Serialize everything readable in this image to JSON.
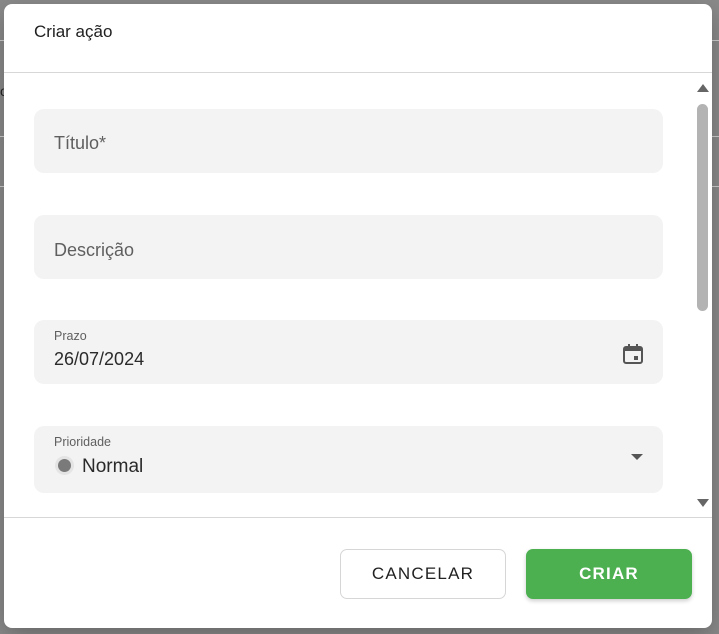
{
  "dialog": {
    "title": "Criar ação"
  },
  "form": {
    "title_field": {
      "placeholder": "Título*"
    },
    "description_field": {
      "placeholder": "Descrição"
    },
    "deadline_field": {
      "label": "Prazo",
      "value": "26/07/2024",
      "icon": "calendar-icon"
    },
    "priority_field": {
      "label": "Prioridade",
      "value": "Normal",
      "indicator_color": "#7a7a7a",
      "icon": "chevron-down-icon"
    }
  },
  "actions": {
    "cancel_label": "CANCELAR",
    "create_label": "CRIAR",
    "create_color": "#4caf50"
  },
  "background": {
    "glyph": "o"
  }
}
